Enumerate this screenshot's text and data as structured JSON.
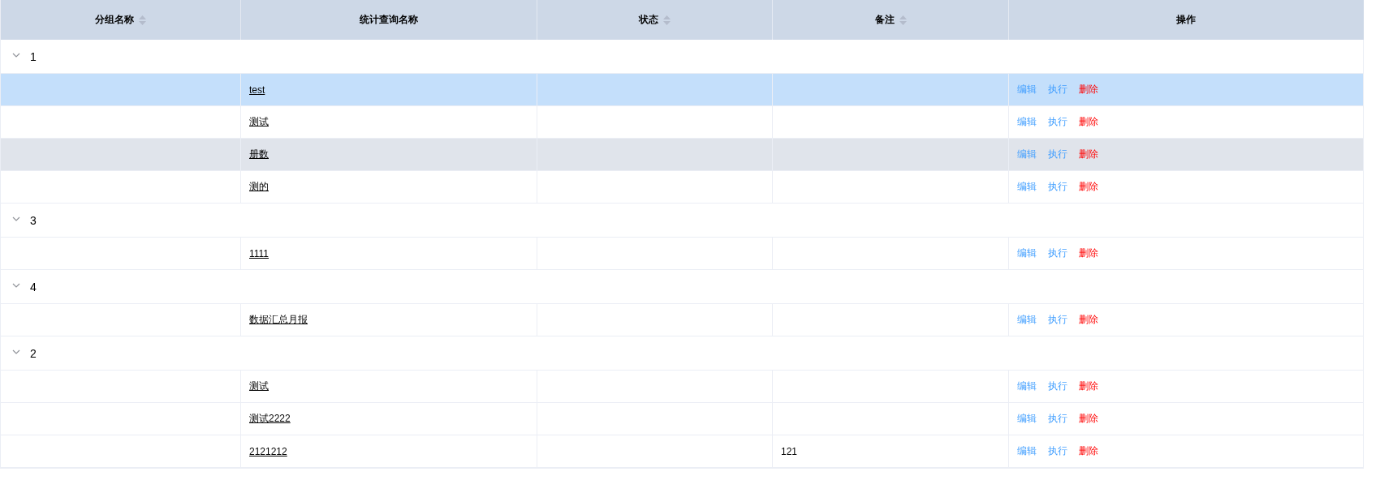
{
  "table": {
    "columns": [
      {
        "label": "分组名称",
        "sortable": true
      },
      {
        "label": "统计查询名称",
        "sortable": false
      },
      {
        "label": "状态",
        "sortable": true
      },
      {
        "label": "备注",
        "sortable": true
      },
      {
        "label": "操作",
        "sortable": false
      }
    ],
    "groups": [
      {
        "label": "1",
        "expanded": true,
        "children": [
          {
            "name": "test",
            "selected": true,
            "striped": false,
            "actions": [
              {
                "label": "编辑",
                "kind": "edit"
              },
              {
                "label": "执行",
                "kind": "run"
              },
              {
                "label": "删除",
                "kind": "delete"
              }
            ]
          },
          {
            "name": "测试",
            "selected": false,
            "striped": false,
            "actions": [
              {
                "label": "编辑",
                "kind": "edit"
              },
              {
                "label": "执行",
                "kind": "run"
              },
              {
                "label": "删除",
                "kind": "delete"
              }
            ]
          },
          {
            "name": "册数",
            "selected": false,
            "striped": true,
            "actions": [
              {
                "label": "编辑",
                "kind": "edit"
              },
              {
                "label": "执行",
                "kind": "run"
              },
              {
                "label": "删除",
                "kind": "delete"
              }
            ]
          },
          {
            "name": "测的",
            "selected": false,
            "striped": false,
            "actions": [
              {
                "label": "编辑",
                "kind": "edit"
              },
              {
                "label": "执行",
                "kind": "run"
              },
              {
                "label": "删除",
                "kind": "delete"
              }
            ]
          }
        ]
      },
      {
        "label": "3",
        "expanded": true,
        "children": [
          {
            "name": "1111",
            "selected": false,
            "striped": false,
            "actions": [
              {
                "label": "编辑",
                "kind": "edit"
              },
              {
                "label": "执行",
                "kind": "run"
              },
              {
                "label": "删除",
                "kind": "delete"
              }
            ]
          }
        ]
      },
      {
        "label": "4",
        "expanded": true,
        "children": [
          {
            "name": "数据汇总月报",
            "selected": false,
            "striped": false,
            "actions": [
              {
                "label": "编辑",
                "kind": "edit"
              },
              {
                "label": "执行",
                "kind": "run"
              },
              {
                "label": "删除",
                "kind": "delete"
              }
            ]
          }
        ]
      },
      {
        "label": "2",
        "expanded": true,
        "children": [
          {
            "name": "测试",
            "selected": false,
            "striped": false,
            "actions": [
              {
                "label": "编辑",
                "kind": "edit"
              },
              {
                "label": "执行",
                "kind": "run"
              },
              {
                "label": "删除",
                "kind": "delete"
              }
            ]
          },
          {
            "name": "测试2222",
            "selected": false,
            "striped": false,
            "actions": [
              {
                "label": "编辑",
                "kind": "edit"
              },
              {
                "label": "执行",
                "kind": "run"
              },
              {
                "label": "删除",
                "kind": "delete"
              }
            ]
          },
          {
            "name": "2121212",
            "remark": "121",
            "selected": false,
            "striped": false,
            "actions": [
              {
                "label": "编辑",
                "kind": "edit"
              },
              {
                "label": "执行",
                "kind": "run"
              },
              {
                "label": "删除",
                "kind": "delete"
              }
            ]
          }
        ]
      }
    ]
  }
}
